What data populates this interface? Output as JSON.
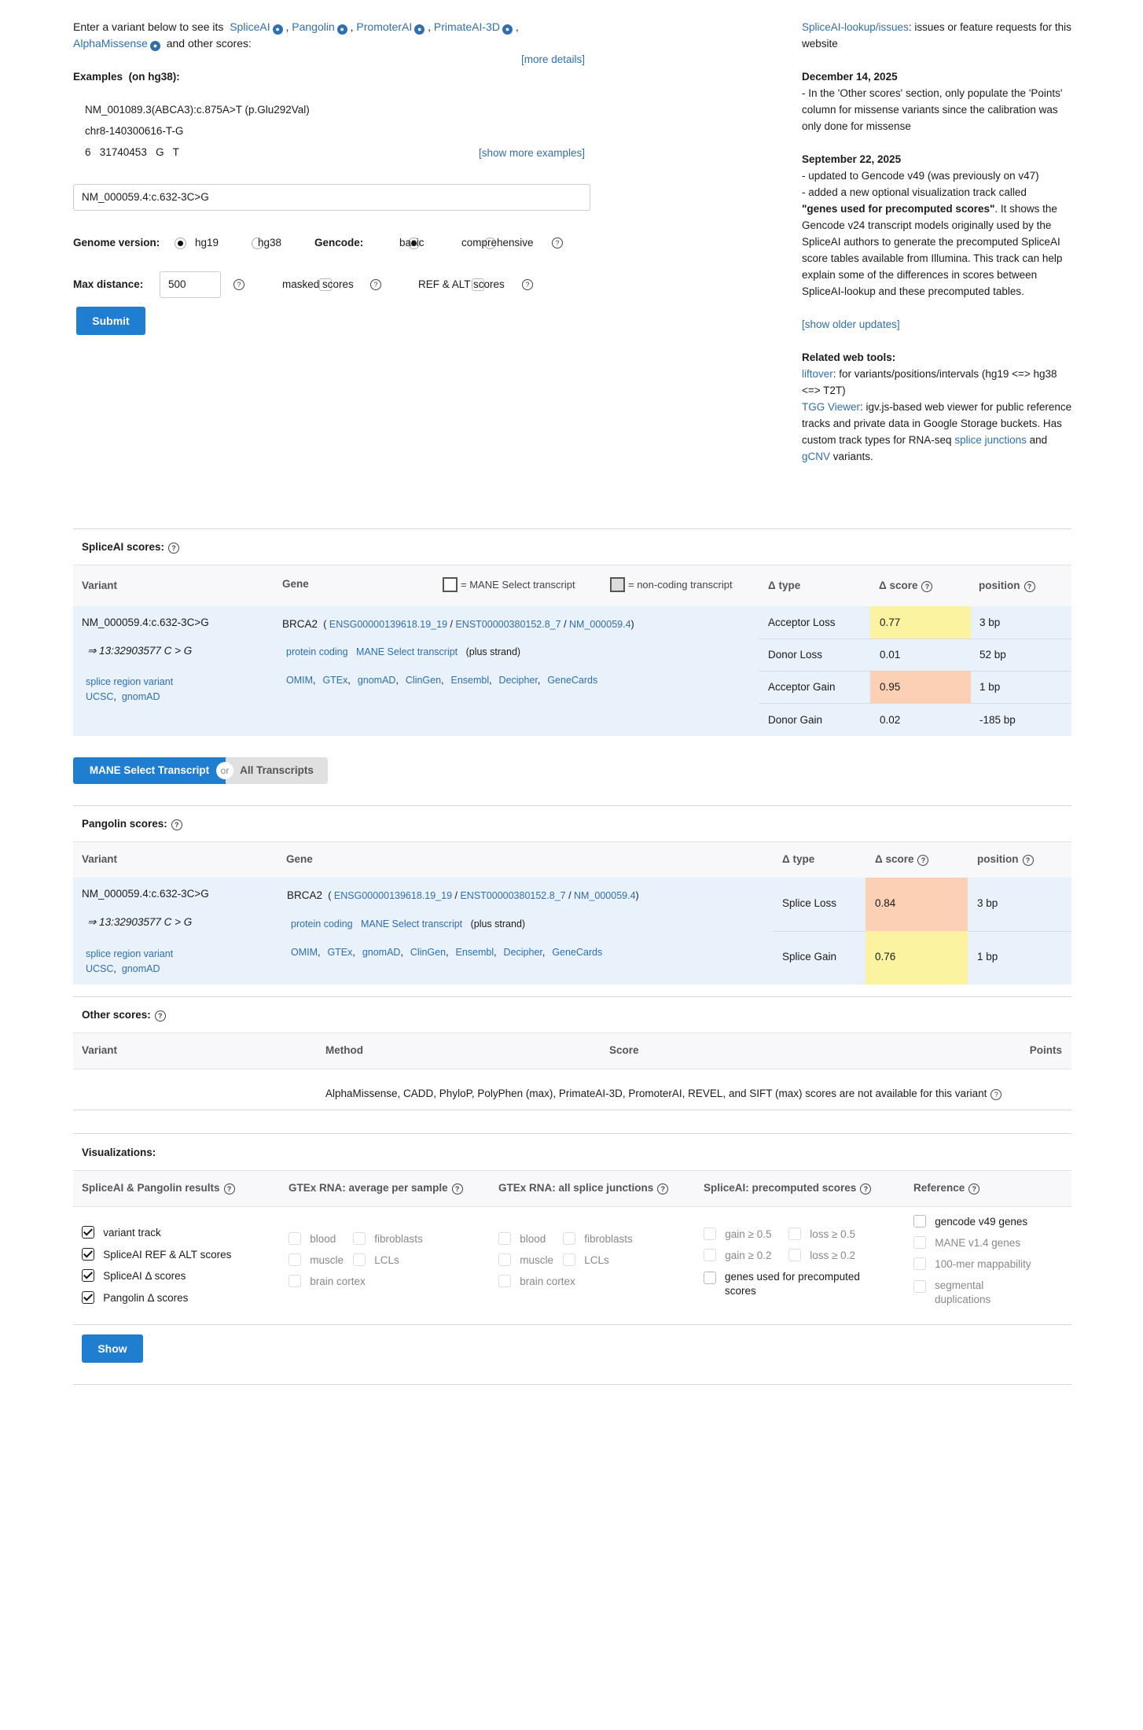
{
  "intro": {
    "text1": "Enter a variant below to see its",
    "tools": [
      "SpliceAI",
      "Pangolin",
      "PromoterAI",
      "PrimateAI-3D",
      "AlphaMissense"
    ],
    "text2": "and other scores:",
    "more_details": "[more details]"
  },
  "examples": {
    "title": "Examples",
    "build": "(on hg38):",
    "items": [
      "NM_001089.3(ABCA3):c.875A>T (p.Glu292Val)",
      "chr8-140300616-T-G",
      "6   31740453   G   T"
    ],
    "show_more": "[show more examples]"
  },
  "search": {
    "value": "NM_000059.4:c.632-3C>G"
  },
  "genome": {
    "label": "Genome version:",
    "options": [
      "hg19",
      "hg38"
    ],
    "selected": "hg19"
  },
  "gencode": {
    "label": "Gencode:",
    "options": [
      "basic",
      "comprehensive"
    ],
    "selected": "basic"
  },
  "max_distance": {
    "label": "Max distance:",
    "value": "500"
  },
  "options": {
    "masked": "masked scores",
    "ref_alt": "REF & ALT scores"
  },
  "submit_label": "Submit",
  "sidebar": {
    "issues_link": "SpliceAI-lookup/issues",
    "issues_text": ": issues or feature requests for this website",
    "updates": [
      {
        "date": "December 14, 2025",
        "lines": [
          "- In the 'Other scores' section, only populate the 'Points' column for missense variants since the calibration was only done for missense"
        ]
      },
      {
        "date": "September 22, 2025",
        "lines": [
          "- updated to Gencode v49 (was previously on v47)",
          "- added a new optional visualization track called",
          "\"genes used for precomputed scores\"",
          ". It shows the Gencode v24 transcript models originally used by the SpliceAI authors to generate the precomputed SpliceAI score tables available from Illumina. This track can help explain some of the differences in scores between SpliceAI-lookup and these precomputed tables."
        ]
      }
    ],
    "show_older": "[show older updates]",
    "related_title": "Related web tools:",
    "liftover_link": "liftover",
    "liftover_text": ": for variants/positions/intervals (hg19 <=> hg38 <=> T2T)",
    "tgg_link": "TGG Viewer",
    "tgg_text": ": igv.js-based web viewer for public reference tracks and private data in Google Storage buckets. Has custom track types for RNA-seq ",
    "splice_junctions": "splice junctions",
    "and": " and ",
    "gcnv": "gCNV",
    "variants": " variants."
  },
  "spliceai": {
    "title": "SpliceAI scores:",
    "headers": {
      "variant": "Variant",
      "gene": "Gene",
      "mane_legend": "= MANE Select transcript",
      "noncoding_legend": "= non-coding transcript",
      "type": "Δ type",
      "score": "Δ score",
      "position": "position"
    },
    "variant": "NM_000059.4:c.632-3C>G",
    "variant_pos": "⇒ 13:32903577 C > G",
    "consequence": "splice region variant",
    "links": [
      "UCSC",
      "gnomAD"
    ],
    "gene": "BRCA2",
    "ids": [
      "ENSG00000139618.19_19",
      "ENST00000380152.8_7",
      "NM_000059.4"
    ],
    "biotype": "protein coding",
    "mane": "MANE Select transcript",
    "strand": "(plus strand)",
    "gene_links": [
      "OMIM",
      "GTEx",
      "gnomAD",
      "ClinGen",
      "Ensembl",
      "Decipher",
      "GeneCards"
    ],
    "rows": [
      {
        "type": "Acceptor Loss",
        "score": "0.77",
        "pos": "3 bp",
        "color": "#fcf3a1"
      },
      {
        "type": "Donor Loss",
        "score": "0.01",
        "pos": "52 bp",
        "color": ""
      },
      {
        "type": "Acceptor Gain",
        "score": "0.95",
        "pos": "1 bp",
        "color": "#fbd0b5"
      },
      {
        "type": "Donor Gain",
        "score": "0.02",
        "pos": "-185 bp",
        "color": ""
      }
    ]
  },
  "toggle": {
    "mane": "MANE Select Transcript",
    "or": "or",
    "all": "All Transcripts"
  },
  "pangolin": {
    "title": "Pangolin scores:",
    "headers": {
      "variant": "Variant",
      "gene": "Gene",
      "type": "Δ type",
      "score": "Δ score",
      "position": "position"
    },
    "variant": "NM_000059.4:c.632-3C>G",
    "variant_pos": "⇒ 13:32903577 C > G",
    "consequence": "splice region variant",
    "links": [
      "UCSC",
      "gnomAD"
    ],
    "gene": "BRCA2",
    "ids": [
      "ENSG00000139618.19_19",
      "ENST00000380152.8_7",
      "NM_000059.4"
    ],
    "biotype": "protein coding",
    "mane": "MANE Select transcript",
    "strand": "(plus strand)",
    "gene_links": [
      "OMIM",
      "GTEx",
      "gnomAD",
      "ClinGen",
      "Ensembl",
      "Decipher",
      "GeneCards"
    ],
    "rows": [
      {
        "type": "Splice Loss",
        "score": "0.84",
        "pos": "3 bp",
        "color": "#fbd0b5"
      },
      {
        "type": "Splice Gain",
        "score": "0.76",
        "pos": "1 bp",
        "color": "#fcf3a1"
      }
    ]
  },
  "other": {
    "title": "Other scores:",
    "headers": {
      "variant": "Variant",
      "method": "Method",
      "score": "Score",
      "points": "Points"
    },
    "message": "AlphaMissense,  CADD,  PhyloP,  PolyPhen (max),  PrimateAI-3D,  PromoterAI,  REVEL,  and SIFT (max) scores are not available for this variant"
  },
  "viz": {
    "title": "Visualizations:",
    "headers": [
      "SpliceAI & Pangolin results",
      "GTEx RNA: average per sample",
      "GTEx RNA: all splice junctions",
      "SpliceAI: precomputed scores",
      "Reference"
    ],
    "col1": [
      "variant track",
      "SpliceAI REF & ALT scores",
      "SpliceAI Δ  scores",
      "Pangolin Δ  scores"
    ],
    "gtex_tissues": [
      "blood",
      "fibroblasts",
      "muscle",
      "LCLs",
      "brain cortex"
    ],
    "precomputed": [
      "gain ≥ 0.5",
      "loss ≥ 0.5",
      "gain ≥ 0.2",
      "loss ≥ 0.2",
      "genes used for precomputed scores"
    ],
    "reference": [
      "gencode v49 genes",
      "MANE v1.4 genes",
      "100-mer mappability",
      "segmental duplications"
    ],
    "show_label": "Show"
  }
}
